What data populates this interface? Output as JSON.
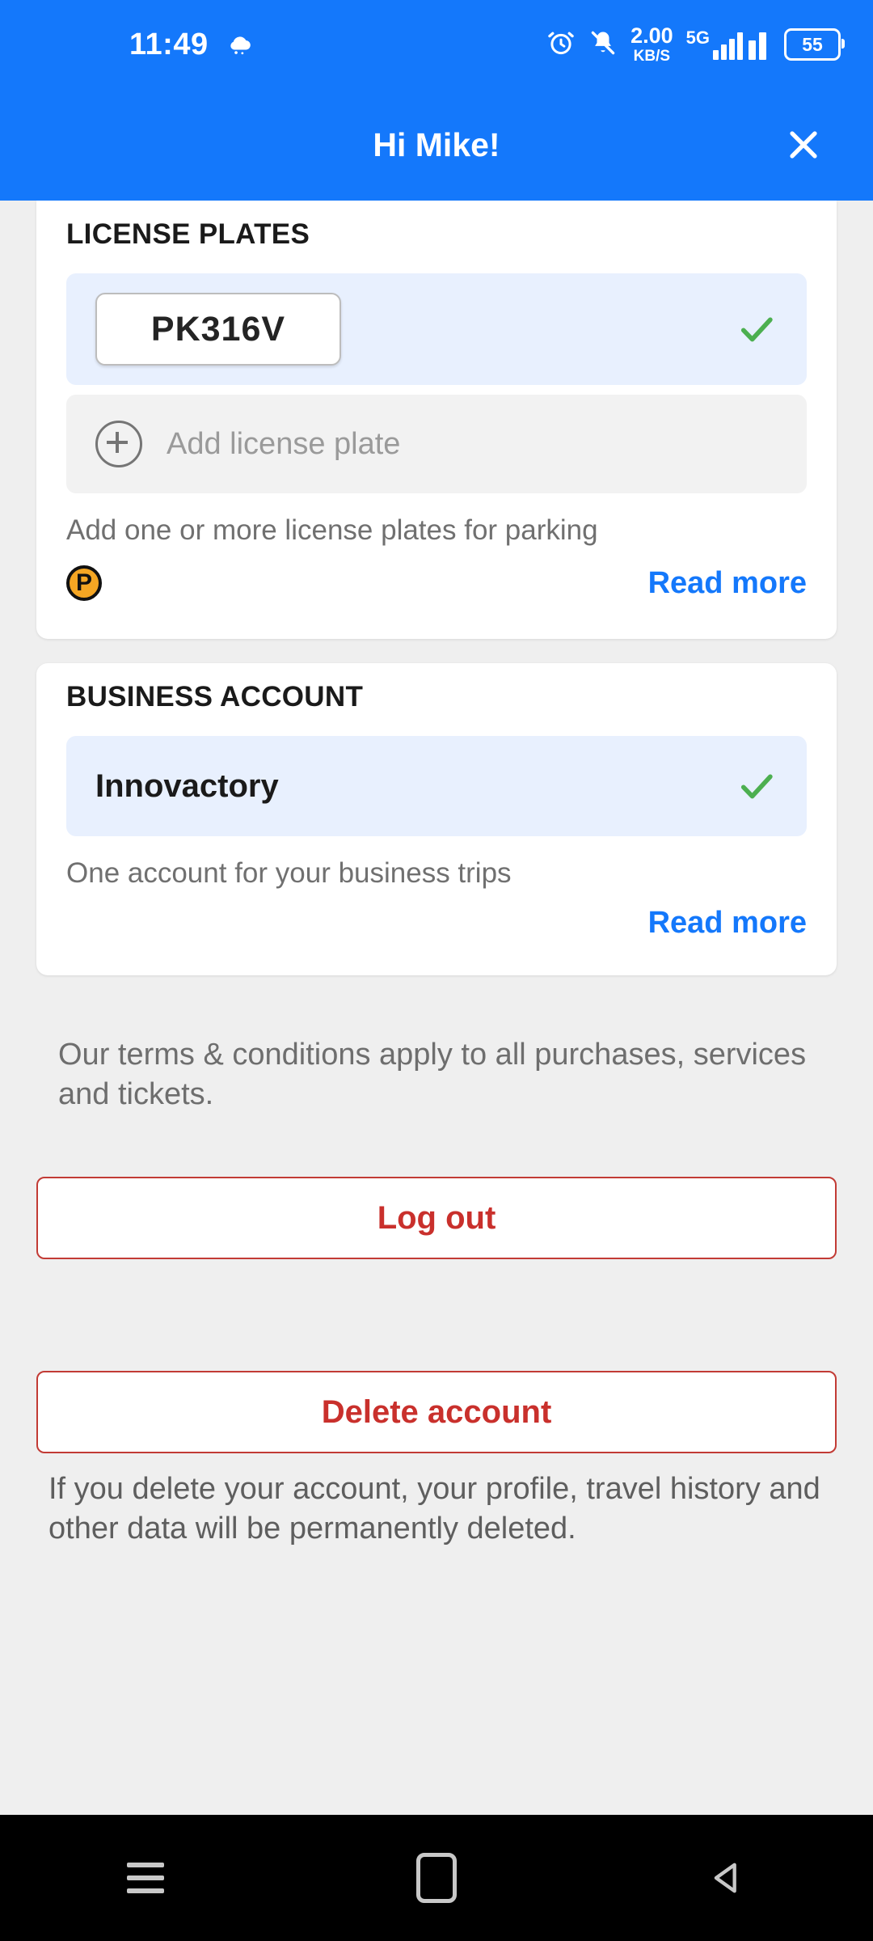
{
  "status_bar": {
    "time": "11:49",
    "weather_icon": "cloud-icon",
    "alarm_icon": "alarm-clock-icon",
    "mute_icon": "bell-muted-icon",
    "net_speed_value": "2.00",
    "net_speed_unit": "KB/S",
    "network_type": "5G",
    "battery_level": "55"
  },
  "app_bar": {
    "title": "Hi Mike!",
    "close_icon": "close-icon"
  },
  "license_plates_card": {
    "title": "LICENSE PLATES",
    "plates": [
      {
        "value": "PK316V",
        "selected": true,
        "check_icon": "check-icon"
      }
    ],
    "add_label": "Add license plate",
    "add_icon": "plus-circle-icon",
    "helper_text": "Add one or more license plates for parking",
    "parking_icon": "parking-p-icon",
    "read_more_label": "Read more"
  },
  "business_account_card": {
    "title": "BUSINESS ACCOUNT",
    "account_name": "Innovactory",
    "check_icon": "check-icon",
    "helper_text": "One account for your business trips",
    "read_more_label": "Read more"
  },
  "terms_text": "Our terms & conditions apply to all purchases, services and tickets.",
  "actions": {
    "logout_label": "Log out",
    "delete_label": "Delete account",
    "delete_note": "If you delete your account, your profile, travel history and other data will be permanently deleted."
  },
  "nav_bar": {
    "recents_icon": "menu-icon",
    "home_icon": "home-square-icon",
    "back_icon": "back-triangle-icon"
  },
  "colors": {
    "primary_blue": "#1478FB",
    "page_background": "#EFEFEF",
    "selected_row": "#E8F0FE",
    "check_green": "#4CAF50",
    "danger_red": "#C9302C",
    "parking_orange": "#F5A623"
  }
}
